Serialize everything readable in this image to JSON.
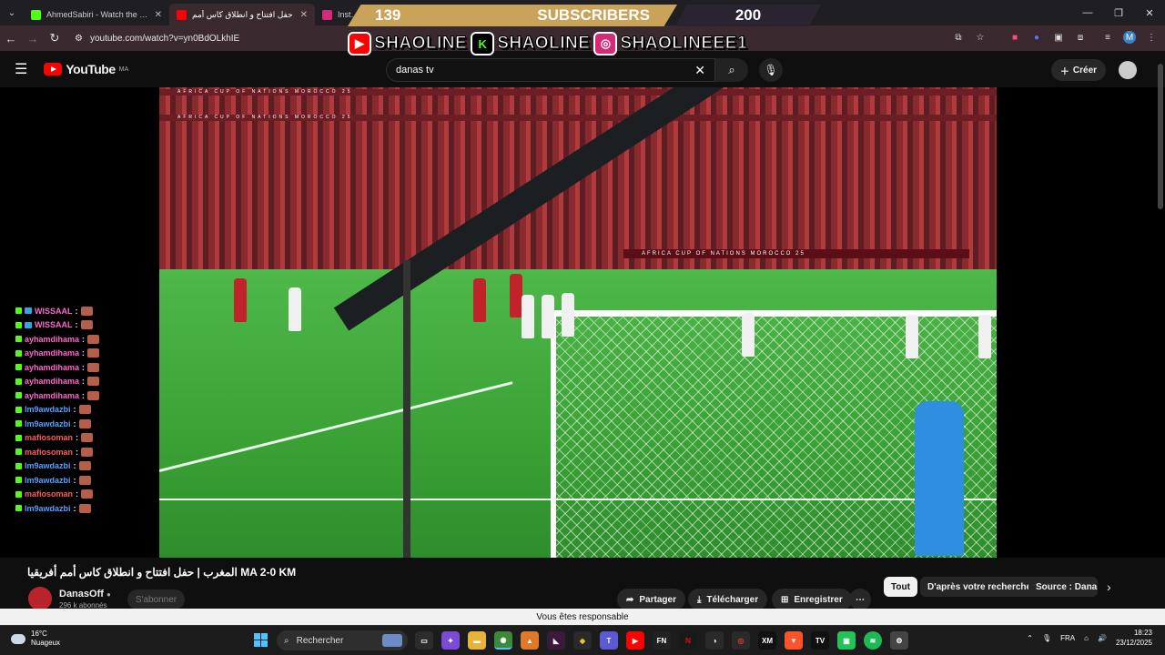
{
  "browser": {
    "tabs": [
      {
        "title": "AhmedSabiri - Watch the VOD",
        "favicon_color": "#53fc18",
        "active": false
      },
      {
        "title": "حفل افتتاح و انطلاق كاس أمم",
        "favicon_color": "#ff0000",
        "active": true
      },
      {
        "title": "Instagram",
        "favicon_color": "#d62976",
        "active": false
      }
    ],
    "url": "youtube.com/watch?v=yn0BdOLkhIE"
  },
  "overlay": {
    "count_left": "139",
    "label": "SUBSCRIBERS",
    "count_right": "200",
    "socials": [
      {
        "platform": "youtube-icon",
        "name": "SHAOLINE",
        "color": "#ff0000"
      },
      {
        "platform": "kick-icon",
        "name": "SHAOLINE",
        "color": "#53fc18"
      },
      {
        "platform": "instagram-icon",
        "name": "SHAOLINEEE1",
        "color": "#d62976"
      }
    ]
  },
  "youtube": {
    "logo_text": "YouTube",
    "region": "MA",
    "search_value": "danas tv",
    "create_label": "Créer"
  },
  "video": {
    "title": "المغرب | حفل افتتاح و انطلاق كاس أمم أفريقيا MA 2-0 KM",
    "channel": "DanasOff",
    "subscribers": "296 k abonnés",
    "subscribe_label": "S'abonner",
    "actions": {
      "share": "Partager",
      "download": "Télécharger",
      "save": "Enregistrer"
    },
    "banner_text": "AFRICA CUP OF NATIONS MOROCCO 25"
  },
  "chips": [
    "Tout",
    "D'après votre recherche",
    "Source : Danas"
  ],
  "notice": "Vous êtes responsable",
  "chat": [
    {
      "user": "WISSAAL",
      "color": "c2"
    },
    {
      "user": "WISSAAL",
      "color": "c2"
    },
    {
      "user": "ayhamdihama",
      "color": "c2"
    },
    {
      "user": "ayhamdihama",
      "color": "c2"
    },
    {
      "user": "ayhamdihama",
      "color": "c2"
    },
    {
      "user": "ayhamdihama",
      "color": "c2"
    },
    {
      "user": "ayhamdihama",
      "color": "c2"
    },
    {
      "user": "lm9awdazbi",
      "color": "c1"
    },
    {
      "user": "lm9awdazbi",
      "color": "c1"
    },
    {
      "user": "mafiosoman",
      "color": "c3"
    },
    {
      "user": "mafiosoman",
      "color": "c3"
    },
    {
      "user": "lm9awdazbi",
      "color": "c1"
    },
    {
      "user": "lm9awdazbi",
      "color": "c1"
    },
    {
      "user": "mafiosoman",
      "color": "c3"
    },
    {
      "user": "lm9awdazbi",
      "color": "c1"
    }
  ],
  "taskbar": {
    "temp": "16°C",
    "weather": "Nuageux",
    "search_placeholder": "Rechercher",
    "lang": "FRA",
    "time": "18:23",
    "date": "23/12/2025"
  }
}
